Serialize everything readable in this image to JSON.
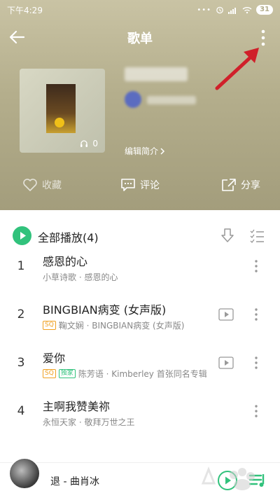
{
  "status_bar": {
    "time": "下午4:29",
    "battery": "31"
  },
  "nav": {
    "title": "歌单"
  },
  "playlist": {
    "listen_count": "0",
    "edit_intro": "编辑简介"
  },
  "actions": {
    "favorite": "收藏",
    "comment": "评论",
    "share": "分享"
  },
  "list": {
    "play_all": "全部播放(4)",
    "songs": [
      {
        "index": "1",
        "title": "感恩的心",
        "meta": "小草诗歌 · 感恩的心"
      },
      {
        "index": "2",
        "title": "BINGBIAN病变 (女声版)",
        "meta": "鞠文娴 · BINGBIAN病变 (女声版)",
        "tag_sq": "SQ"
      },
      {
        "index": "3",
        "title": "爱你",
        "meta": "陈芳语 · Kimberley 首张同名专辑",
        "tag_sq": "SQ",
        "tag_excl": "独家"
      },
      {
        "index": "4",
        "title": "主啊我赞美祢",
        "meta": "永恒天家 · 敬拜万世之王"
      }
    ]
  },
  "mini_player": {
    "title": "退 - 曲肖冰"
  },
  "colors": {
    "accent": "#31c27c",
    "annotation": "#d0202a"
  }
}
